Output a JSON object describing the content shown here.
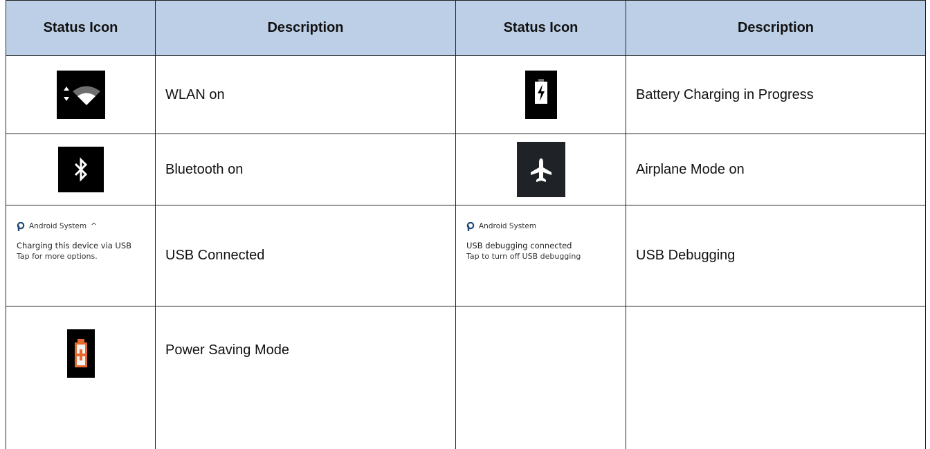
{
  "table": {
    "headers": [
      "Status Icon",
      "Description",
      "Status Icon",
      "Description"
    ],
    "rows": [
      {
        "left_icon": "wlan-icon",
        "left_desc": "WLAN on",
        "right_icon": "battery-charging-icon",
        "right_desc": "Battery Charging in Progress"
      },
      {
        "left_icon": "bluetooth-icon",
        "left_desc": "Bluetooth on",
        "right_icon": "airplane-icon",
        "right_desc": "Airplane Mode on"
      },
      {
        "left_notification": {
          "app": "Android System",
          "chevron": "^",
          "line1": "Charging this device via USB",
          "line2": "Tap for more options."
        },
        "left_desc": "USB Connected",
        "right_notification": {
          "app": "Android System",
          "line1": "USB debugging connected",
          "line2": "Tap to turn off USB debugging"
        },
        "right_desc": "USB Debugging"
      },
      {
        "left_icon": "power-saving-battery-icon",
        "left_desc": "Power Saving Mode",
        "right_icon": "",
        "right_desc": ""
      }
    ]
  },
  "colors": {
    "header_bg": "#bccfe6",
    "notif_accent": "#1f4a78",
    "power_saving": "#e8692d"
  }
}
